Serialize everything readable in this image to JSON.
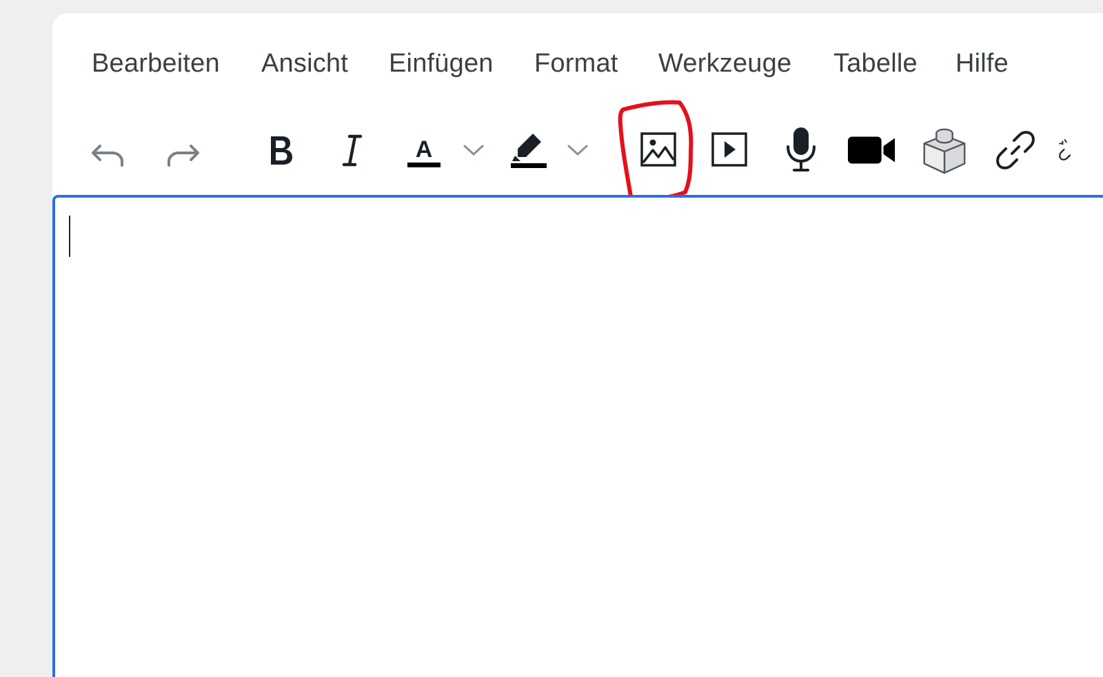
{
  "menubar": {
    "items": [
      {
        "label": "Bearbeiten"
      },
      {
        "label": "Ansicht"
      },
      {
        "label": "Einfügen"
      },
      {
        "label": "Format"
      },
      {
        "label": "Werkzeuge"
      },
      {
        "label": "Tabelle"
      },
      {
        "label": "Hilfe"
      }
    ]
  },
  "toolbar": {
    "tools": [
      {
        "name": "undo",
        "icon": "undo-icon"
      },
      {
        "name": "redo",
        "icon": "redo-icon"
      },
      {
        "name": "bold",
        "icon": "bold-icon"
      },
      {
        "name": "italic",
        "icon": "italic-icon"
      },
      {
        "name": "text-color",
        "icon": "text-color-icon",
        "glyph": "A",
        "swatch": "#000000"
      },
      {
        "name": "highlight-color",
        "icon": "highlighter-icon",
        "swatch": "#000000"
      },
      {
        "name": "image",
        "icon": "image-icon"
      },
      {
        "name": "media",
        "icon": "play-icon"
      },
      {
        "name": "record-audio",
        "icon": "microphone-icon"
      },
      {
        "name": "record-video",
        "icon": "video-camera-icon"
      },
      {
        "name": "apps",
        "icon": "cube-icon"
      },
      {
        "name": "link",
        "icon": "link-icon"
      },
      {
        "name": "unlink",
        "icon": "unlink-icon"
      }
    ]
  },
  "colors": {
    "editor_focus_border": "#2f6fe0",
    "annotation": "#e3111b",
    "menu_text": "#3a3f44",
    "icon_muted": "#6b7178",
    "icon_dark": "#1b2026"
  },
  "editor": {
    "content": ""
  }
}
